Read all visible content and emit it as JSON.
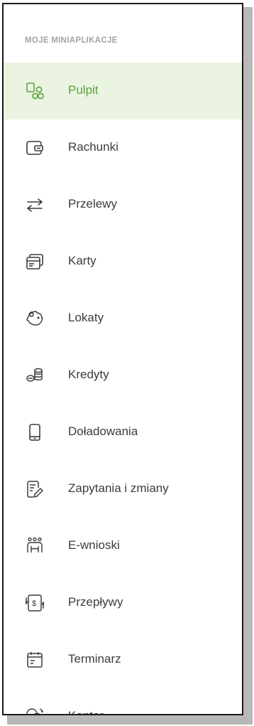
{
  "menu": {
    "title": "MOJE MINIAPLIKACJE",
    "accent_color": "#5aa33c",
    "active_bg_color": "#eaf4e1",
    "items": [
      {
        "label": "Pulpit",
        "icon": "dashboard-icon",
        "active": true
      },
      {
        "label": "Rachunki",
        "icon": "wallet-icon",
        "active": false
      },
      {
        "label": "Przelewy",
        "icon": "transfer-arrows-icon",
        "active": false
      },
      {
        "label": "Karty",
        "icon": "cards-icon",
        "active": false
      },
      {
        "label": "Lokaty",
        "icon": "piggy-bank-icon",
        "active": false
      },
      {
        "label": "Kredyty",
        "icon": "coins-icon",
        "active": false
      },
      {
        "label": "Doładowania",
        "icon": "mobile-phone-icon",
        "active": false
      },
      {
        "label": "Zapytania i zmiany",
        "icon": "document-edit-icon",
        "active": false
      },
      {
        "label": "E-wnioski",
        "icon": "people-group-icon",
        "active": false
      },
      {
        "label": "Przepływy",
        "icon": "cash-flow-icon",
        "active": false
      },
      {
        "label": "Terminarz",
        "icon": "calendar-icon",
        "active": false
      },
      {
        "label": "Kantor",
        "icon": "currency-exchange-icon",
        "active": false
      }
    ]
  }
}
